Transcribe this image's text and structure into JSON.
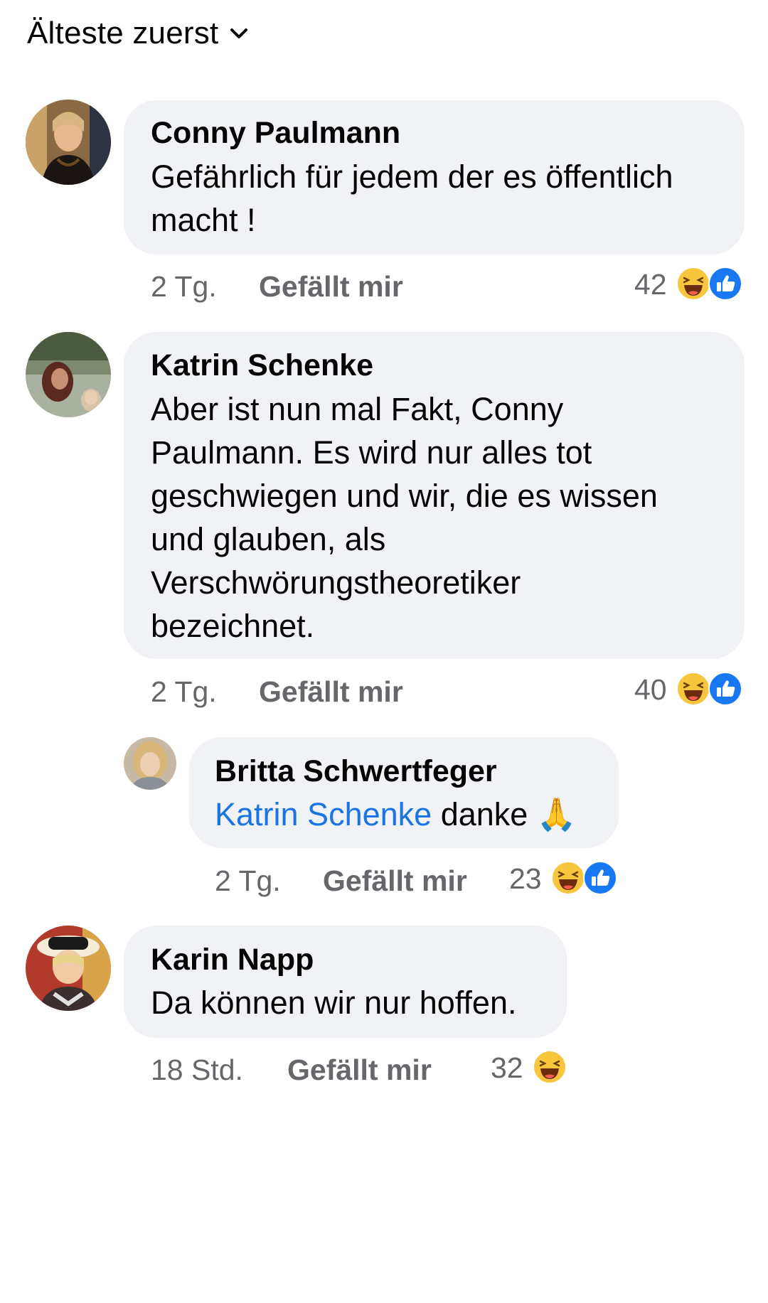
{
  "sort": {
    "label": "Älteste zuerst",
    "icon": "chevron-down-icon"
  },
  "colors": {
    "bubble": "#f0f2f5",
    "mention": "#1b74e4",
    "meta": "#65676b",
    "like_blue": "#1877f2",
    "haha_yellow": "#f7c63c"
  },
  "comments": [
    {
      "author": "Conny Paulmann",
      "lines": [
        "Gefährlich für jedem der es öffentlich",
        "macht !"
      ],
      "time": "2 Tg.",
      "like_label": "Gefällt mir",
      "reaction_count": "42",
      "reactions": [
        "haha-icon",
        "like-icon"
      ]
    },
    {
      "author": "Katrin Schenke",
      "lines": [
        "Aber ist nun mal Fakt, Conny",
        "Paulmann. Es wird nur alles tot",
        "geschwiegen und wir, die es wissen",
        "und glauben, als",
        "Verschwörungstheoretiker",
        "bezeichnet."
      ],
      "time": "2 Tg.",
      "like_label": "Gefällt mir",
      "reaction_count": "40",
      "reactions": [
        "haha-icon",
        "like-icon"
      ],
      "replies": [
        {
          "author": "Britta Schwertfeger",
          "mention": "Katrin Schenke",
          "text": " danke ",
          "emoji": "🙏",
          "time": "2 Tg.",
          "like_label": "Gefällt mir",
          "reaction_count": "23",
          "reactions": [
            "haha-icon",
            "like-icon"
          ]
        }
      ]
    },
    {
      "author": "Karin Napp",
      "lines": [
        "Da können wir nur hoffen."
      ],
      "time": "18 Std.",
      "like_label": "Gefällt mir",
      "reaction_count": "32",
      "reactions": [
        "haha-icon"
      ]
    }
  ]
}
